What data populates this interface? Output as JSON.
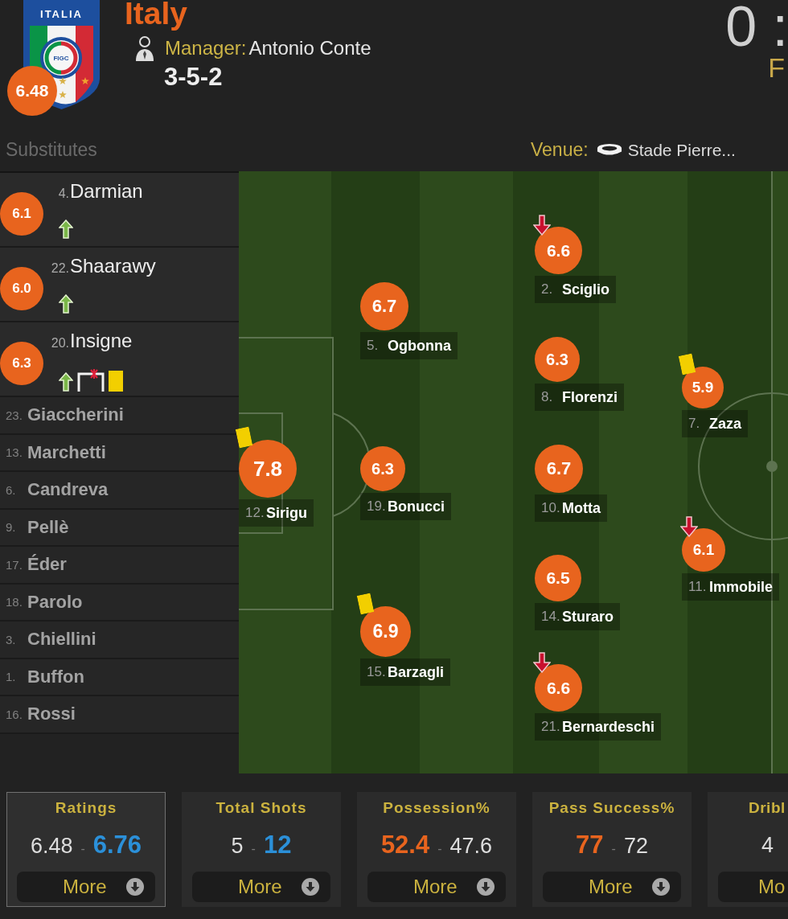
{
  "team": {
    "crest_lettering": "ITALIA",
    "crest_badge": "FIGC",
    "rating": "6.48",
    "name": "Italy",
    "manager_label": "Manager:",
    "manager": "Antonio Conte",
    "formation": "3-5-2"
  },
  "score": {
    "text": "0 :",
    "status": "F"
  },
  "substitutes": {
    "title": "Substitutes",
    "players": [
      {
        "kind": "played",
        "number": "4.",
        "name": "Darmian",
        "rating": "6.1",
        "events": [
          {
            "kind": "sub_in"
          }
        ]
      },
      {
        "kind": "played",
        "number": "22.",
        "name": "Shaarawy",
        "rating": "6.0",
        "events": [
          {
            "kind": "sub_in"
          }
        ]
      },
      {
        "kind": "played",
        "number": "20.",
        "name": "Insigne",
        "rating": "6.3",
        "events": [
          {
            "kind": "sub_in"
          },
          {
            "kind": "goal_frame_cross"
          },
          {
            "kind": "yellow_card"
          }
        ]
      },
      {
        "kind": "unused",
        "number": "23.",
        "name": "Giaccherini"
      },
      {
        "kind": "unused",
        "number": "13.",
        "name": "Marchetti"
      },
      {
        "kind": "unused",
        "number": "6.",
        "name": "Candreva"
      },
      {
        "kind": "unused",
        "number": "9.",
        "name": "Pellè"
      },
      {
        "kind": "unused",
        "number": "17.",
        "name": "Éder"
      },
      {
        "kind": "unused",
        "number": "18.",
        "name": "Parolo"
      },
      {
        "kind": "unused",
        "number": "3.",
        "name": "Chiellini"
      },
      {
        "kind": "unused",
        "number": "1.",
        "name": "Buffon"
      },
      {
        "kind": "unused",
        "number": "16.",
        "name": "Rossi"
      }
    ]
  },
  "venue": {
    "label": "Venue:",
    "name": "Stade Pierre..."
  },
  "pitch": {
    "lines": [
      {
        "players": [
          {
            "number": "12.",
            "name": "Sirigu",
            "rating": "7.8",
            "events": [
              {
                "kind": "yellow_card"
              }
            ]
          }
        ]
      },
      {
        "players": [
          {
            "number": "5.",
            "name": "Ogbonna",
            "rating": "6.7"
          },
          {
            "number": "19.",
            "name": "Bonucci",
            "rating": "6.3"
          },
          {
            "number": "15.",
            "name": "Barzagli",
            "rating": "6.9",
            "events": [
              {
                "kind": "yellow_card"
              }
            ]
          }
        ]
      },
      {
        "players": [
          {
            "number": "2.",
            "name": "Sciglio",
            "rating": "6.6",
            "events": [
              {
                "kind": "sub_out"
              }
            ]
          },
          {
            "number": "8.",
            "name": "Florenzi",
            "rating": "6.3"
          },
          {
            "number": "10.",
            "name": "Motta",
            "rating": "6.7"
          },
          {
            "number": "14.",
            "name": "Sturaro",
            "rating": "6.5"
          },
          {
            "number": "21.",
            "name": "Bernardeschi",
            "rating": "6.6",
            "events": [
              {
                "kind": "sub_out"
              }
            ]
          }
        ]
      },
      {
        "players": [
          {
            "number": "7.",
            "name": "Zaza",
            "rating": "5.9",
            "events": [
              {
                "kind": "yellow_card"
              }
            ]
          },
          {
            "number": "11.",
            "name": "Immobile",
            "rating": "6.1",
            "events": [
              {
                "kind": "sub_out"
              }
            ]
          }
        ]
      }
    ]
  },
  "stats": [
    {
      "title": "Ratings",
      "selected": true,
      "home": {
        "value": "6.48",
        "leading": false
      },
      "separator": "-",
      "away": {
        "value": "6.76",
        "leading": true
      },
      "more": "More"
    },
    {
      "title": "Total Shots",
      "selected": false,
      "home": {
        "value": "5",
        "leading": false
      },
      "separator": "-",
      "away": {
        "value": "12",
        "leading": true
      },
      "more": "More"
    },
    {
      "title": "Possession%",
      "selected": false,
      "home": {
        "value": "52.4",
        "leading": true
      },
      "separator": "-",
      "away": {
        "value": "47.6",
        "leading": false
      },
      "more": "More"
    },
    {
      "title": "Pass Success%",
      "selected": false,
      "home": {
        "value": "77",
        "leading": true
      },
      "separator": "-",
      "away": {
        "value": "72",
        "leading": false
      },
      "more": "More"
    },
    {
      "title": "Dribl",
      "selected": false,
      "home": {
        "value": "4",
        "leading": false
      },
      "more": "Mo"
    }
  ]
}
